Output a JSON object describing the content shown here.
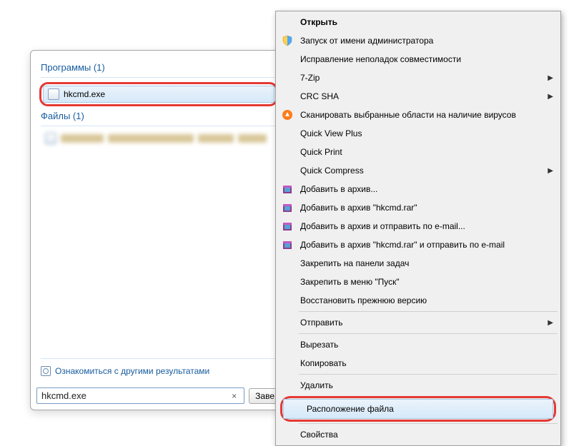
{
  "search_panel": {
    "group_programs": "Программы (1)",
    "result_item": "hkcmd.exe",
    "group_files": "Файлы (1)",
    "more_results": "Ознакомиться с другими результатами",
    "search_value": "hkcmd.exe",
    "shutdown_button": "Заве"
  },
  "context_menu": {
    "open": "Открыть",
    "run_as_admin": "Запуск от имени администратора",
    "troubleshoot": "Исправление неполадок совместимости",
    "seven_zip": "7-Zip",
    "crc_sha": "CRC SHA",
    "scan_virus": "Сканировать выбранные области на наличие вирусов",
    "quick_view": "Quick View Plus",
    "quick_print": "Quick Print",
    "quick_compress": "Quick Compress",
    "add_archive": "Добавить в архив...",
    "add_archive_named": "Добавить в архив \"hkcmd.rar\"",
    "add_send_email": "Добавить в архив и отправить по e-mail...",
    "add_named_send_email": "Добавить в архив \"hkcmd.rar\" и отправить по e-mail",
    "pin_taskbar": "Закрепить на панели задач",
    "pin_start": "Закрепить в меню \"Пуск\"",
    "restore_version": "Восстановить прежнюю версию",
    "send_to": "Отправить",
    "cut": "Вырезать",
    "copy": "Копировать",
    "delete": "Удалить",
    "file_location": "Расположение файла",
    "properties": "Свойства"
  }
}
